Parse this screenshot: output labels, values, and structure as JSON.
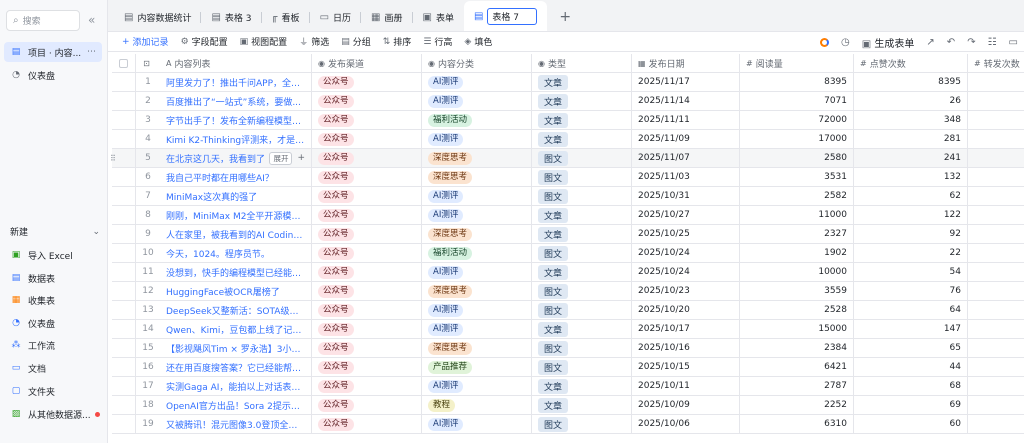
{
  "sidebar": {
    "search_placeholder": "搜索",
    "items": [
      {
        "label": "项目 · 内容...",
        "icon": "table-icon",
        "active": true
      },
      {
        "label": "仪表盘",
        "icon": "dashboard-icon",
        "active": false
      }
    ],
    "section_label": "新建",
    "create_items": [
      {
        "label": "导入 Excel",
        "icon": "excel-icon"
      },
      {
        "label": "数据表",
        "icon": "table-icon"
      },
      {
        "label": "收集表",
        "icon": "form-icon"
      },
      {
        "label": "仪表盘",
        "icon": "dashboard-icon"
      },
      {
        "label": "工作流",
        "icon": "workflow-icon"
      },
      {
        "label": "文档",
        "icon": "doc-icon"
      },
      {
        "label": "文件夹",
        "icon": "folder-icon"
      },
      {
        "label": "从其他数据源...",
        "icon": "datasource-icon"
      }
    ]
  },
  "tabs": [
    {
      "label": "内容数据统计",
      "icon": "table-icon"
    },
    {
      "label": "表格 3",
      "icon": "table-icon"
    },
    {
      "label": "看板",
      "icon": "kanban-icon"
    },
    {
      "label": "日历",
      "icon": "calendar-icon"
    },
    {
      "label": "画册",
      "icon": "gallery-icon"
    },
    {
      "label": "表单",
      "icon": "form-icon"
    },
    {
      "label": "表格 7",
      "icon": "table-icon",
      "active": true
    }
  ],
  "toolbar": {
    "add_record": "添加记录",
    "field_config": "字段配置",
    "view_config": "视图配置",
    "filter": "筛选",
    "group": "分组",
    "sort": "排序",
    "row_height": "行高",
    "fill_color": "填色",
    "generate_form": "生成表单"
  },
  "columns": {
    "title": "内容列表",
    "source": "发布渠道",
    "category": "内容分类",
    "type": "类型",
    "date": "发布日期",
    "reads": "阅读量",
    "clicks": "点赞次数",
    "forwards": "转发次数"
  },
  "row_tools": {
    "expand": "展开"
  },
  "rows": [
    {
      "n": "1",
      "title": "阿里发力了！推出千问APP，全面对...",
      "source": "公众号",
      "category": "AI测评",
      "cat_style": "ai",
      "type": "文章",
      "date": "2025/11/17",
      "reads": "8395",
      "clicks": "8395"
    },
    {
      "n": "2",
      "title": "百度推出了“一站式”系统，要做...",
      "source": "公众号",
      "category": "AI测评",
      "cat_style": "ai",
      "type": "文章",
      "date": "2025/11/14",
      "reads": "7071",
      "clicks": "26"
    },
    {
      "n": "3",
      "title": "字节出手了！发布全新编程模型，9...",
      "source": "公众号",
      "category": "福利活动",
      "cat_style": "fuli",
      "type": "文章",
      "date": "2025/11/11",
      "reads": "72000",
      "clicks": "348"
    },
    {
      "n": "4",
      "title": "Kimi K2-Thinking评测来，才是真...",
      "source": "公众号",
      "category": "AI测评",
      "cat_style": "ai",
      "type": "文章",
      "date": "2025/11/09",
      "reads": "17000",
      "clicks": "281"
    },
    {
      "n": "5",
      "title": "在北京这几天，我看到了",
      "source": "公众号",
      "category": "深度思考",
      "cat_style": "deep",
      "type": "图文",
      "date": "2025/11/07",
      "reads": "2580",
      "clicks": "241"
    },
    {
      "n": "6",
      "title": "我自己平时都在用哪些AI？",
      "source": "公众号",
      "category": "深度思考",
      "cat_style": "deep",
      "type": "图文",
      "date": "2025/11/03",
      "reads": "3531",
      "clicks": "132"
    },
    {
      "n": "7",
      "title": "MiniMax这次真的强了",
      "source": "公众号",
      "category": "AI测评",
      "cat_style": "ai",
      "type": "图文",
      "date": "2025/10/31",
      "reads": "2582",
      "clicks": "62"
    },
    {
      "n": "8",
      "title": "刚刚，MiniMax M2全平开源模型第一...",
      "source": "公众号",
      "category": "AI测评",
      "cat_style": "ai",
      "type": "文章",
      "date": "2025/10/27",
      "reads": "11000",
      "clicks": "122"
    },
    {
      "n": "9",
      "title": "人在家里，被我看到的AI Coding实...",
      "source": "公众号",
      "category": "深度思考",
      "cat_style": "deep",
      "type": "文章",
      "date": "2025/10/25",
      "reads": "2327",
      "clicks": "92"
    },
    {
      "n": "10",
      "title": "今天，1024。程序员节。",
      "source": "公众号",
      "category": "福利活动",
      "cat_style": "fuli",
      "type": "图文",
      "date": "2025/10/24",
      "reads": "1902",
      "clicks": "22"
    },
    {
      "n": "11",
      "title": "没想到，快手的编程模型已经能打GL...",
      "source": "公众号",
      "category": "AI测评",
      "cat_style": "ai",
      "type": "文章",
      "date": "2025/10/24",
      "reads": "10000",
      "clicks": "54"
    },
    {
      "n": "12",
      "title": "HuggingFace被OCR屠榜了",
      "source": "公众号",
      "category": "深度思考",
      "cat_style": "deep",
      "type": "图文",
      "date": "2025/10/23",
      "reads": "3559",
      "clicks": "76"
    },
    {
      "n": "13",
      "title": "DeepSeek又整新活：SOTA级OCR，...",
      "source": "公众号",
      "category": "AI测评",
      "cat_style": "ai",
      "type": "图文",
      "date": "2025/10/20",
      "reads": "2528",
      "clicks": "64"
    },
    {
      "n": "14",
      "title": "Qwen、Kimi，豆包都上线了记忆功...",
      "source": "公众号",
      "category": "AI测评",
      "cat_style": "ai",
      "type": "文章",
      "date": "2025/10/17",
      "reads": "15000",
      "clicks": "147"
    },
    {
      "n": "15",
      "title": "【影视飓风Tim × 罗永浩】3小时对...",
      "source": "公众号",
      "category": "深度思考",
      "cat_style": "deep",
      "type": "图文",
      "date": "2025/10/16",
      "reads": "2384",
      "clicks": "65"
    },
    {
      "n": "16",
      "title": "还在用百度搜答案？它已经能帮你做...",
      "source": "公众号",
      "category": "产品推荐",
      "cat_style": "prod",
      "type": "图文",
      "date": "2025/10/15",
      "reads": "6421",
      "clicks": "44"
    },
    {
      "n": "17",
      "title": "实测Gaga AI，能拍以上对话表演，...",
      "source": "公众号",
      "category": "AI测评",
      "cat_style": "ai",
      "type": "文章",
      "date": "2025/10/11",
      "reads": "2787",
      "clicks": "68"
    },
    {
      "n": "18",
      "title": "OpenAI官方出品！Sora 2提示词指南",
      "source": "公众号",
      "category": "教程",
      "cat_style": "tool",
      "type": "文章",
      "date": "2025/10/09",
      "reads": "2252",
      "clicks": "69"
    },
    {
      "n": "19",
      "title": "又被腾讯！混元图像3.0登顶全球第一...",
      "source": "公众号",
      "category": "AI测评",
      "cat_style": "ai",
      "type": "图文",
      "date": "2025/10/06",
      "reads": "6310",
      "clicks": "60"
    }
  ],
  "colors": {
    "accent": "#3370ff",
    "border": "#e5e6eb",
    "sidebar_bg": "#f7f8fa"
  }
}
